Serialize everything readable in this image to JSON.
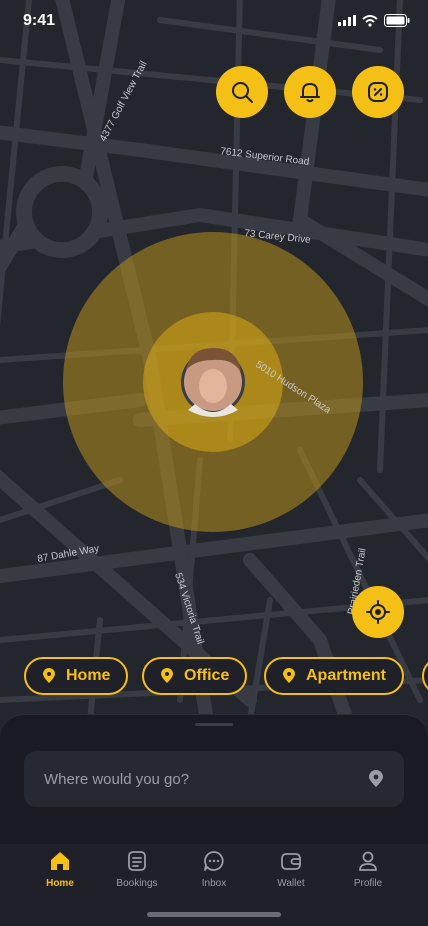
{
  "status": {
    "time": "9:41"
  },
  "map": {
    "streets": [
      "4377 Golf View Trail",
      "7612 Superior Road",
      "73 Carey Drive",
      "5010 Hudson Plaza",
      "87 Dahle Way",
      "534 Victoria Trail",
      "Prairieden Trail"
    ]
  },
  "actions": {
    "search_icon": "search-icon",
    "bell_icon": "bell-icon",
    "discount_icon": "discount-icon",
    "locate_icon": "locate-icon"
  },
  "chips": [
    {
      "label": "Home"
    },
    {
      "label": "Office"
    },
    {
      "label": "Apartment"
    }
  ],
  "search": {
    "placeholder": "Where would you go?"
  },
  "tabs": [
    {
      "label": "Home",
      "active": true
    },
    {
      "label": "Bookings",
      "active": false
    },
    {
      "label": "Inbox",
      "active": false
    },
    {
      "label": "Wallet",
      "active": false
    },
    {
      "label": "Profile",
      "active": false
    }
  ],
  "colors": {
    "accent": "#f5c016",
    "background": "#1f2028"
  }
}
